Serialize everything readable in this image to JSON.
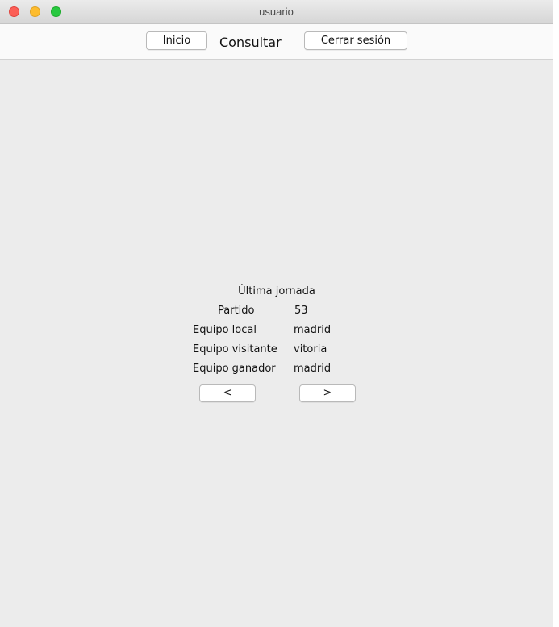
{
  "window": {
    "title": "usuario",
    "controls": {
      "close_color": "#fc5f57",
      "minimize_color": "#fdbc2e",
      "maximize_color": "#28c840"
    }
  },
  "toolbar": {
    "inicio_label": "Inicio",
    "consultar_label": "Consultar",
    "cerrar_sesion_label": "Cerrar sesión"
  },
  "panel": {
    "title": "Última jornada",
    "rows": [
      {
        "label": "Partido",
        "value": "53"
      },
      {
        "label": "Equipo local",
        "value": "madrid"
      },
      {
        "label": "Equipo visitante",
        "value": "vitoria"
      },
      {
        "label": "Equipo ganador",
        "value": "madrid"
      }
    ],
    "prev_label": "<",
    "next_label": ">"
  }
}
